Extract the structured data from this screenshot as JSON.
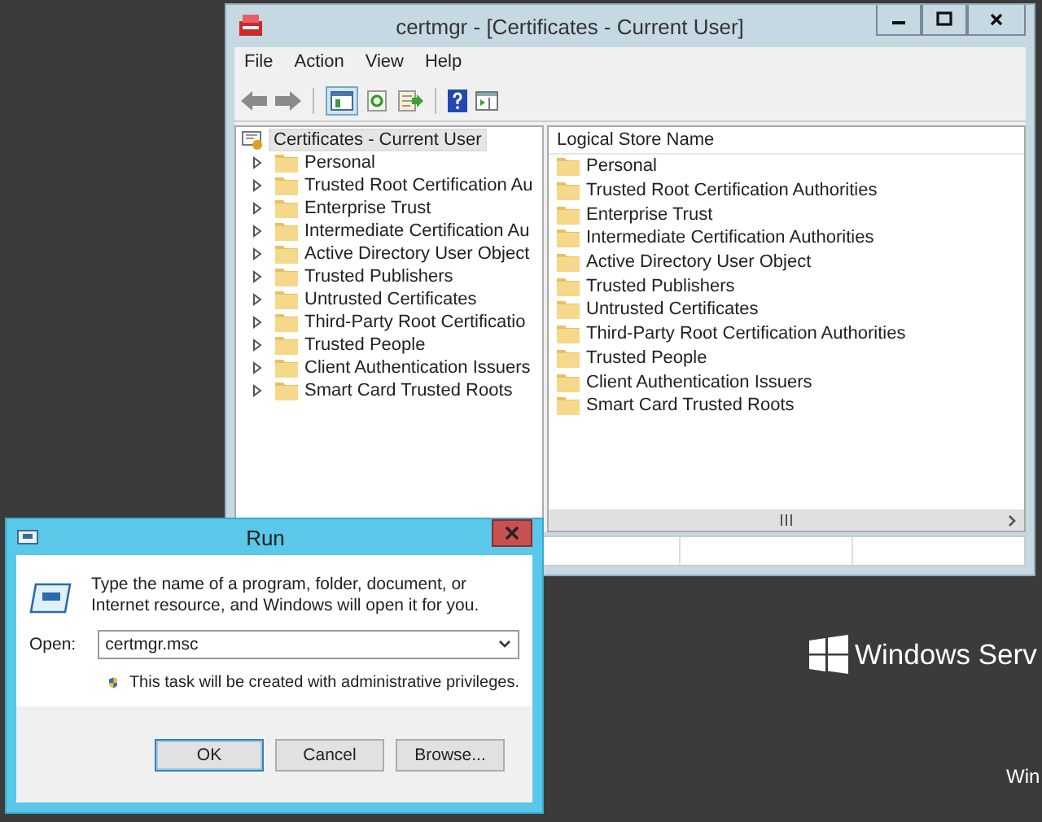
{
  "desktop": {
    "branding": "Windows Serv",
    "corner_text": "Win"
  },
  "certmgr": {
    "title": "certmgr - [Certificates - Current User]",
    "menu": [
      "File",
      "Action",
      "View",
      "Help"
    ],
    "tree": {
      "label": "Certificates - Current User",
      "selected": true,
      "children": [
        {
          "label": "Personal",
          "expanded": false
        },
        {
          "label": "Trusted Root Certification Au",
          "expanded": false
        },
        {
          "label": "Enterprise Trust",
          "expanded": false
        },
        {
          "label": "Intermediate Certification Au",
          "expanded": false
        },
        {
          "label": "Active Directory User Object",
          "expanded": false
        },
        {
          "label": "Trusted Publishers",
          "expanded": false
        },
        {
          "label": "Untrusted Certificates",
          "expanded": false
        },
        {
          "label": "Third-Party Root Certificatio",
          "expanded": false
        },
        {
          "label": "Trusted People",
          "expanded": false
        },
        {
          "label": "Client Authentication Issuers",
          "expanded": false
        },
        {
          "label": "Smart Card Trusted Roots",
          "expanded": false
        }
      ]
    },
    "list": {
      "column": "Logical Store Name",
      "items": [
        "Personal",
        "Trusted Root Certification Authorities",
        "Enterprise Trust",
        "Intermediate Certification Authorities",
        "Active Directory User Object",
        "Trusted Publishers",
        "Untrusted Certificates",
        "Third-Party Root Certification Authorities",
        "Trusted People",
        "Client Authentication Issuers",
        "Smart Card Trusted Roots"
      ]
    }
  },
  "run": {
    "title": "Run",
    "description": "Type the name of a program, folder, document, or Internet resource, and Windows will open it for you.",
    "open_label": "Open:",
    "value": "certmgr.msc",
    "admin_note": "This task will be created with administrative privileges.",
    "buttons": [
      {
        "label": "OK",
        "kind": "default"
      },
      {
        "label": "Cancel",
        "kind": "normal"
      },
      {
        "label": "Browse...",
        "kind": "normal"
      }
    ]
  }
}
